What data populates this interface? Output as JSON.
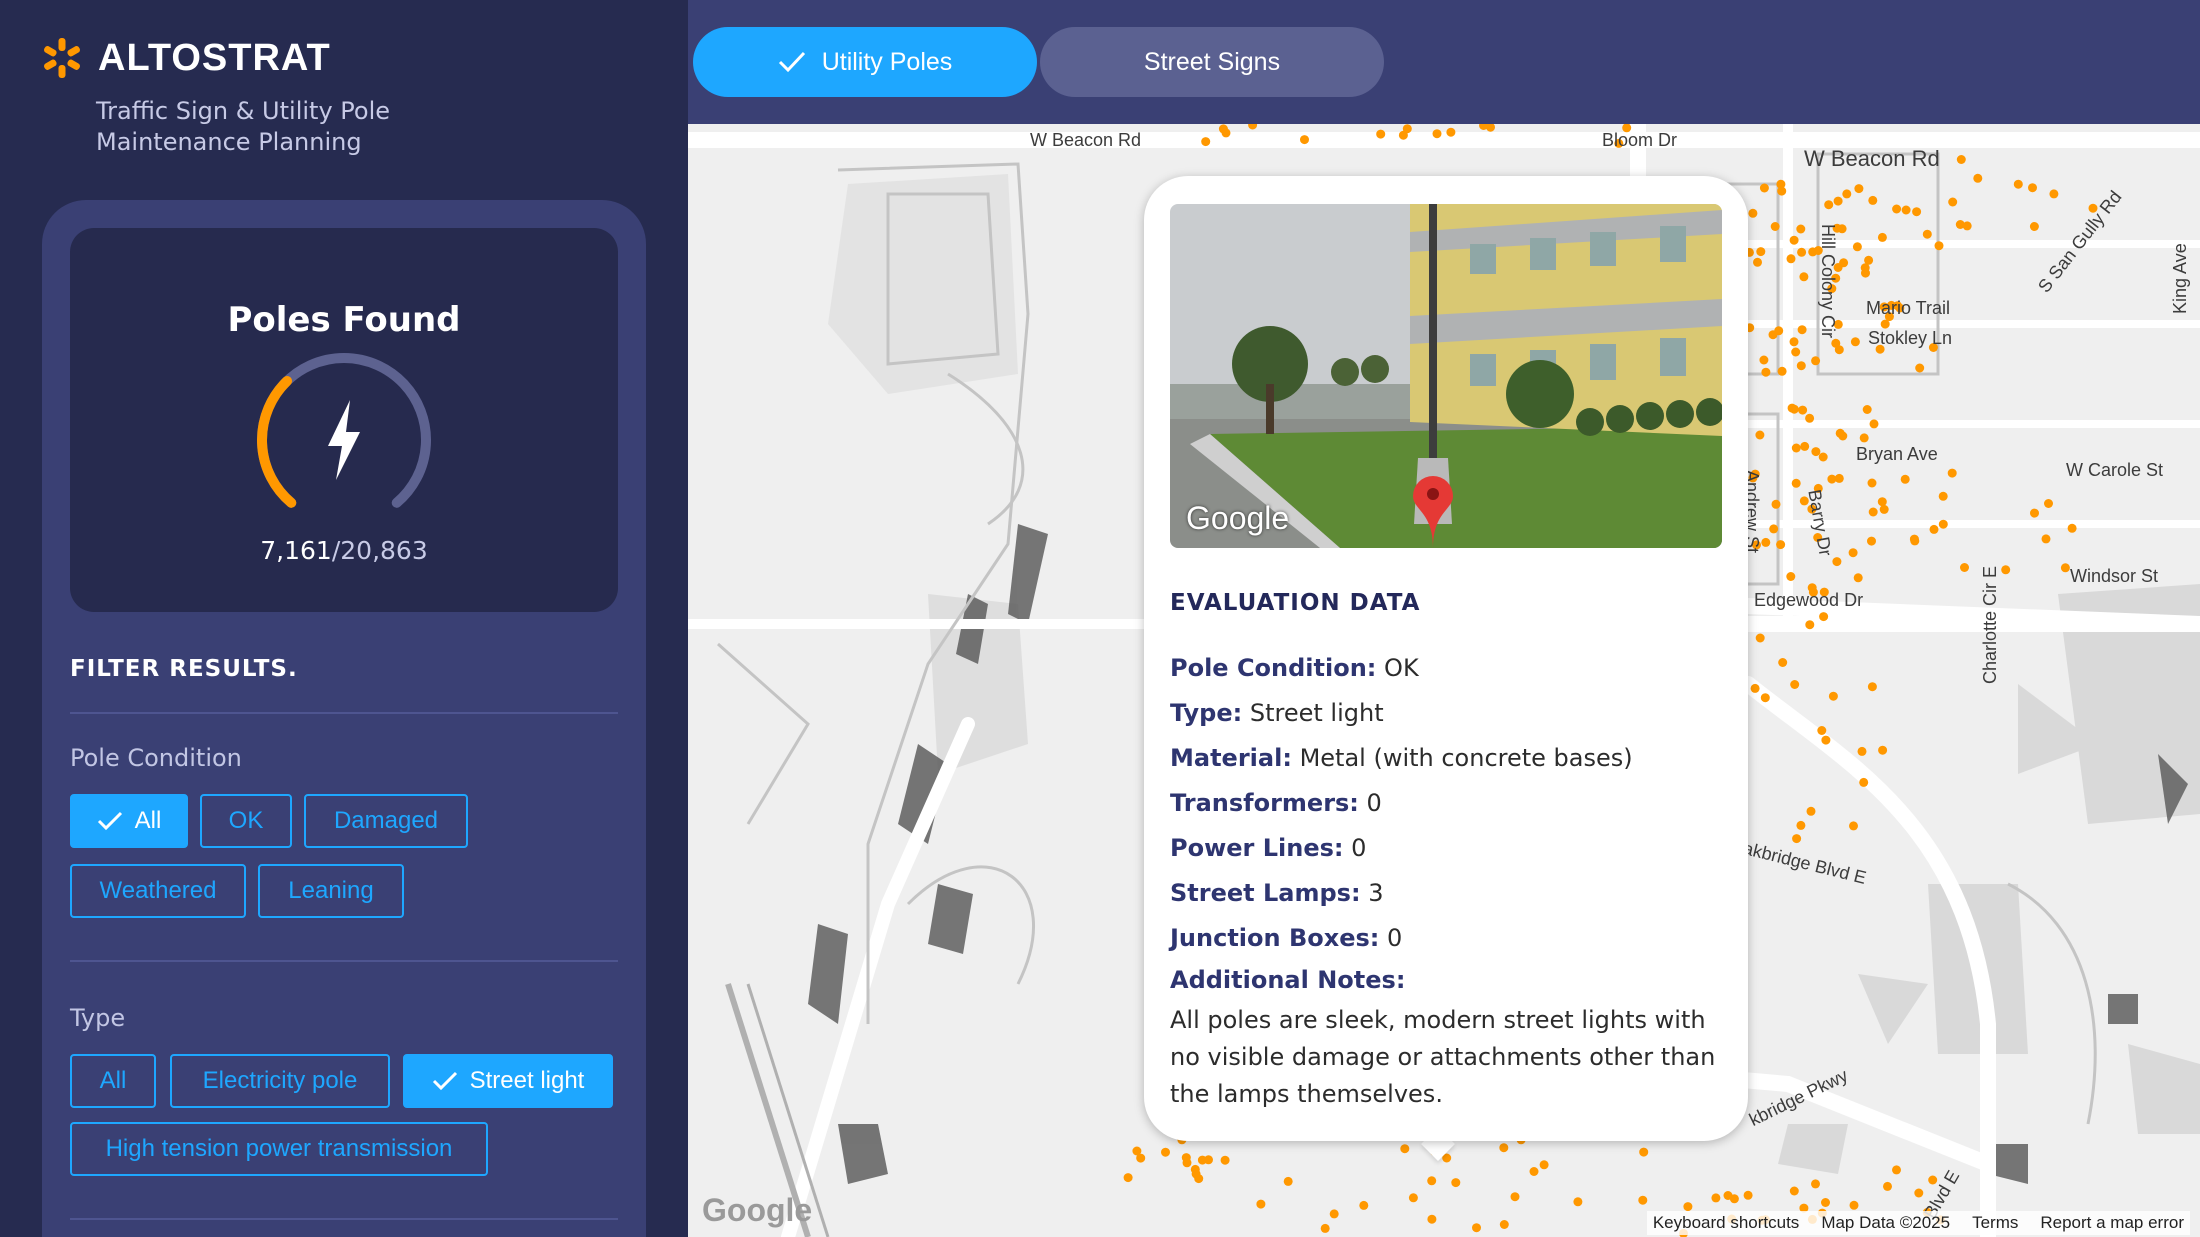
{
  "brand": {
    "name": "ALTOSTRAT",
    "tagline": "Traffic Sign & Utility Pole Maintenance Planning"
  },
  "gauge": {
    "title": "Poles Found",
    "found": "7,161",
    "total": "/20,863",
    "fraction": 0.343,
    "accent": "#ff9800"
  },
  "filters": {
    "heading": "FILTER RESULTS.",
    "condition": {
      "label": "Pole Condition",
      "options": [
        "All",
        "OK",
        "Damaged",
        "Weathered",
        "Leaning"
      ],
      "selected": "All"
    },
    "type": {
      "label": "Type",
      "options": [
        "All",
        "Electricity pole",
        "Street light",
        "High tension power transmission"
      ],
      "selected": "Street light"
    }
  },
  "tabs": [
    {
      "label": "Utility Poles",
      "active": true
    },
    {
      "label": "Street Signs",
      "active": false
    }
  ],
  "map": {
    "streets": [
      "W Beacon Rd",
      "Bloom Dr",
      "W Beacon Rd",
      "Hill Colony Cir",
      "S San Gully Rd",
      "King Ave",
      "Mario Trail",
      "Stokley Ln",
      "Bryan Ave",
      "W Carole St",
      "Andrew St",
      "Barry Dr",
      "Charlotte Cir E",
      "Windsor St",
      "Edgewood Dr",
      "akbridge Blvd E",
      "kbridge Pkwy",
      "Blvd E"
    ],
    "google": "Google",
    "footer": [
      "Keyboard shortcuts",
      "Map Data ©2025",
      "Terms",
      "Report a map error"
    ]
  },
  "popup": {
    "photo_google": "Google",
    "title": "EVALUATION DATA",
    "fields": [
      {
        "key": "Pole Condition:",
        "value": "OK"
      },
      {
        "key": "Type:",
        "value": "Street light"
      },
      {
        "key": "Material:",
        "value": "Metal (with concrete bases)"
      },
      {
        "key": "Transformers:",
        "value": "0"
      },
      {
        "key": "Power Lines:",
        "value": "0"
      },
      {
        "key": "Street Lamps:",
        "value": "3"
      },
      {
        "key": "Junction Boxes:",
        "value": "0"
      }
    ],
    "notes_label": "Additional Notes:",
    "notes": "All poles are sleek, modern street lights with no visible damage or attachments other than the lamps themselves."
  },
  "colors": {
    "accent": "#1ea7ff",
    "sidebar": "#262b50",
    "panel": "#3a4074",
    "marker": "#ff9800",
    "pin": "#e53935"
  }
}
